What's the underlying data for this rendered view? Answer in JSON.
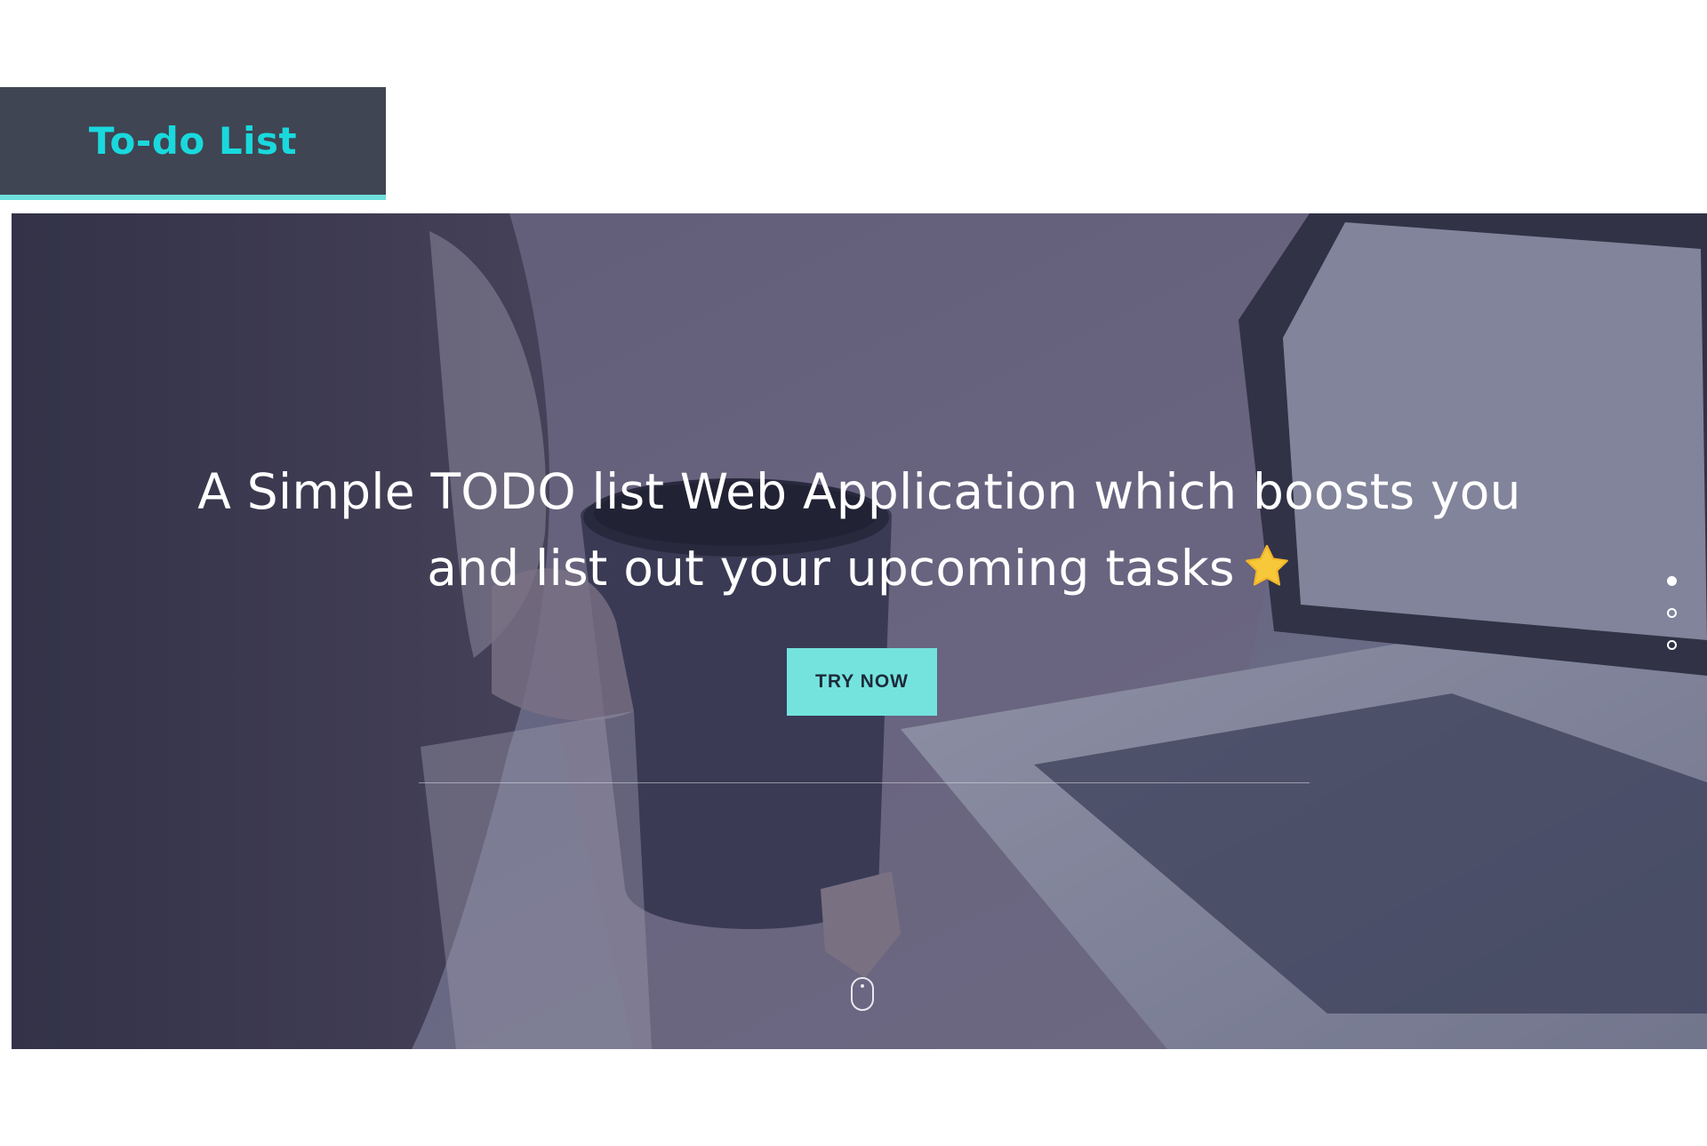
{
  "brand": {
    "title": "To-do List",
    "color": "#19d9dd",
    "background": "#3f4552",
    "underline_color": "#6fdfdc"
  },
  "hero": {
    "headline_line1": "A Simple TODO list Web Application which boosts you",
    "headline_line2": "and list out your upcoming tasks",
    "headline_icon": "star-icon",
    "cta_label": "TRY NOW",
    "cta_color": "#74e3de",
    "slider": {
      "count": 3,
      "active_index": 0
    },
    "scroll_hint_icon": "mouse-scroll-icon"
  }
}
